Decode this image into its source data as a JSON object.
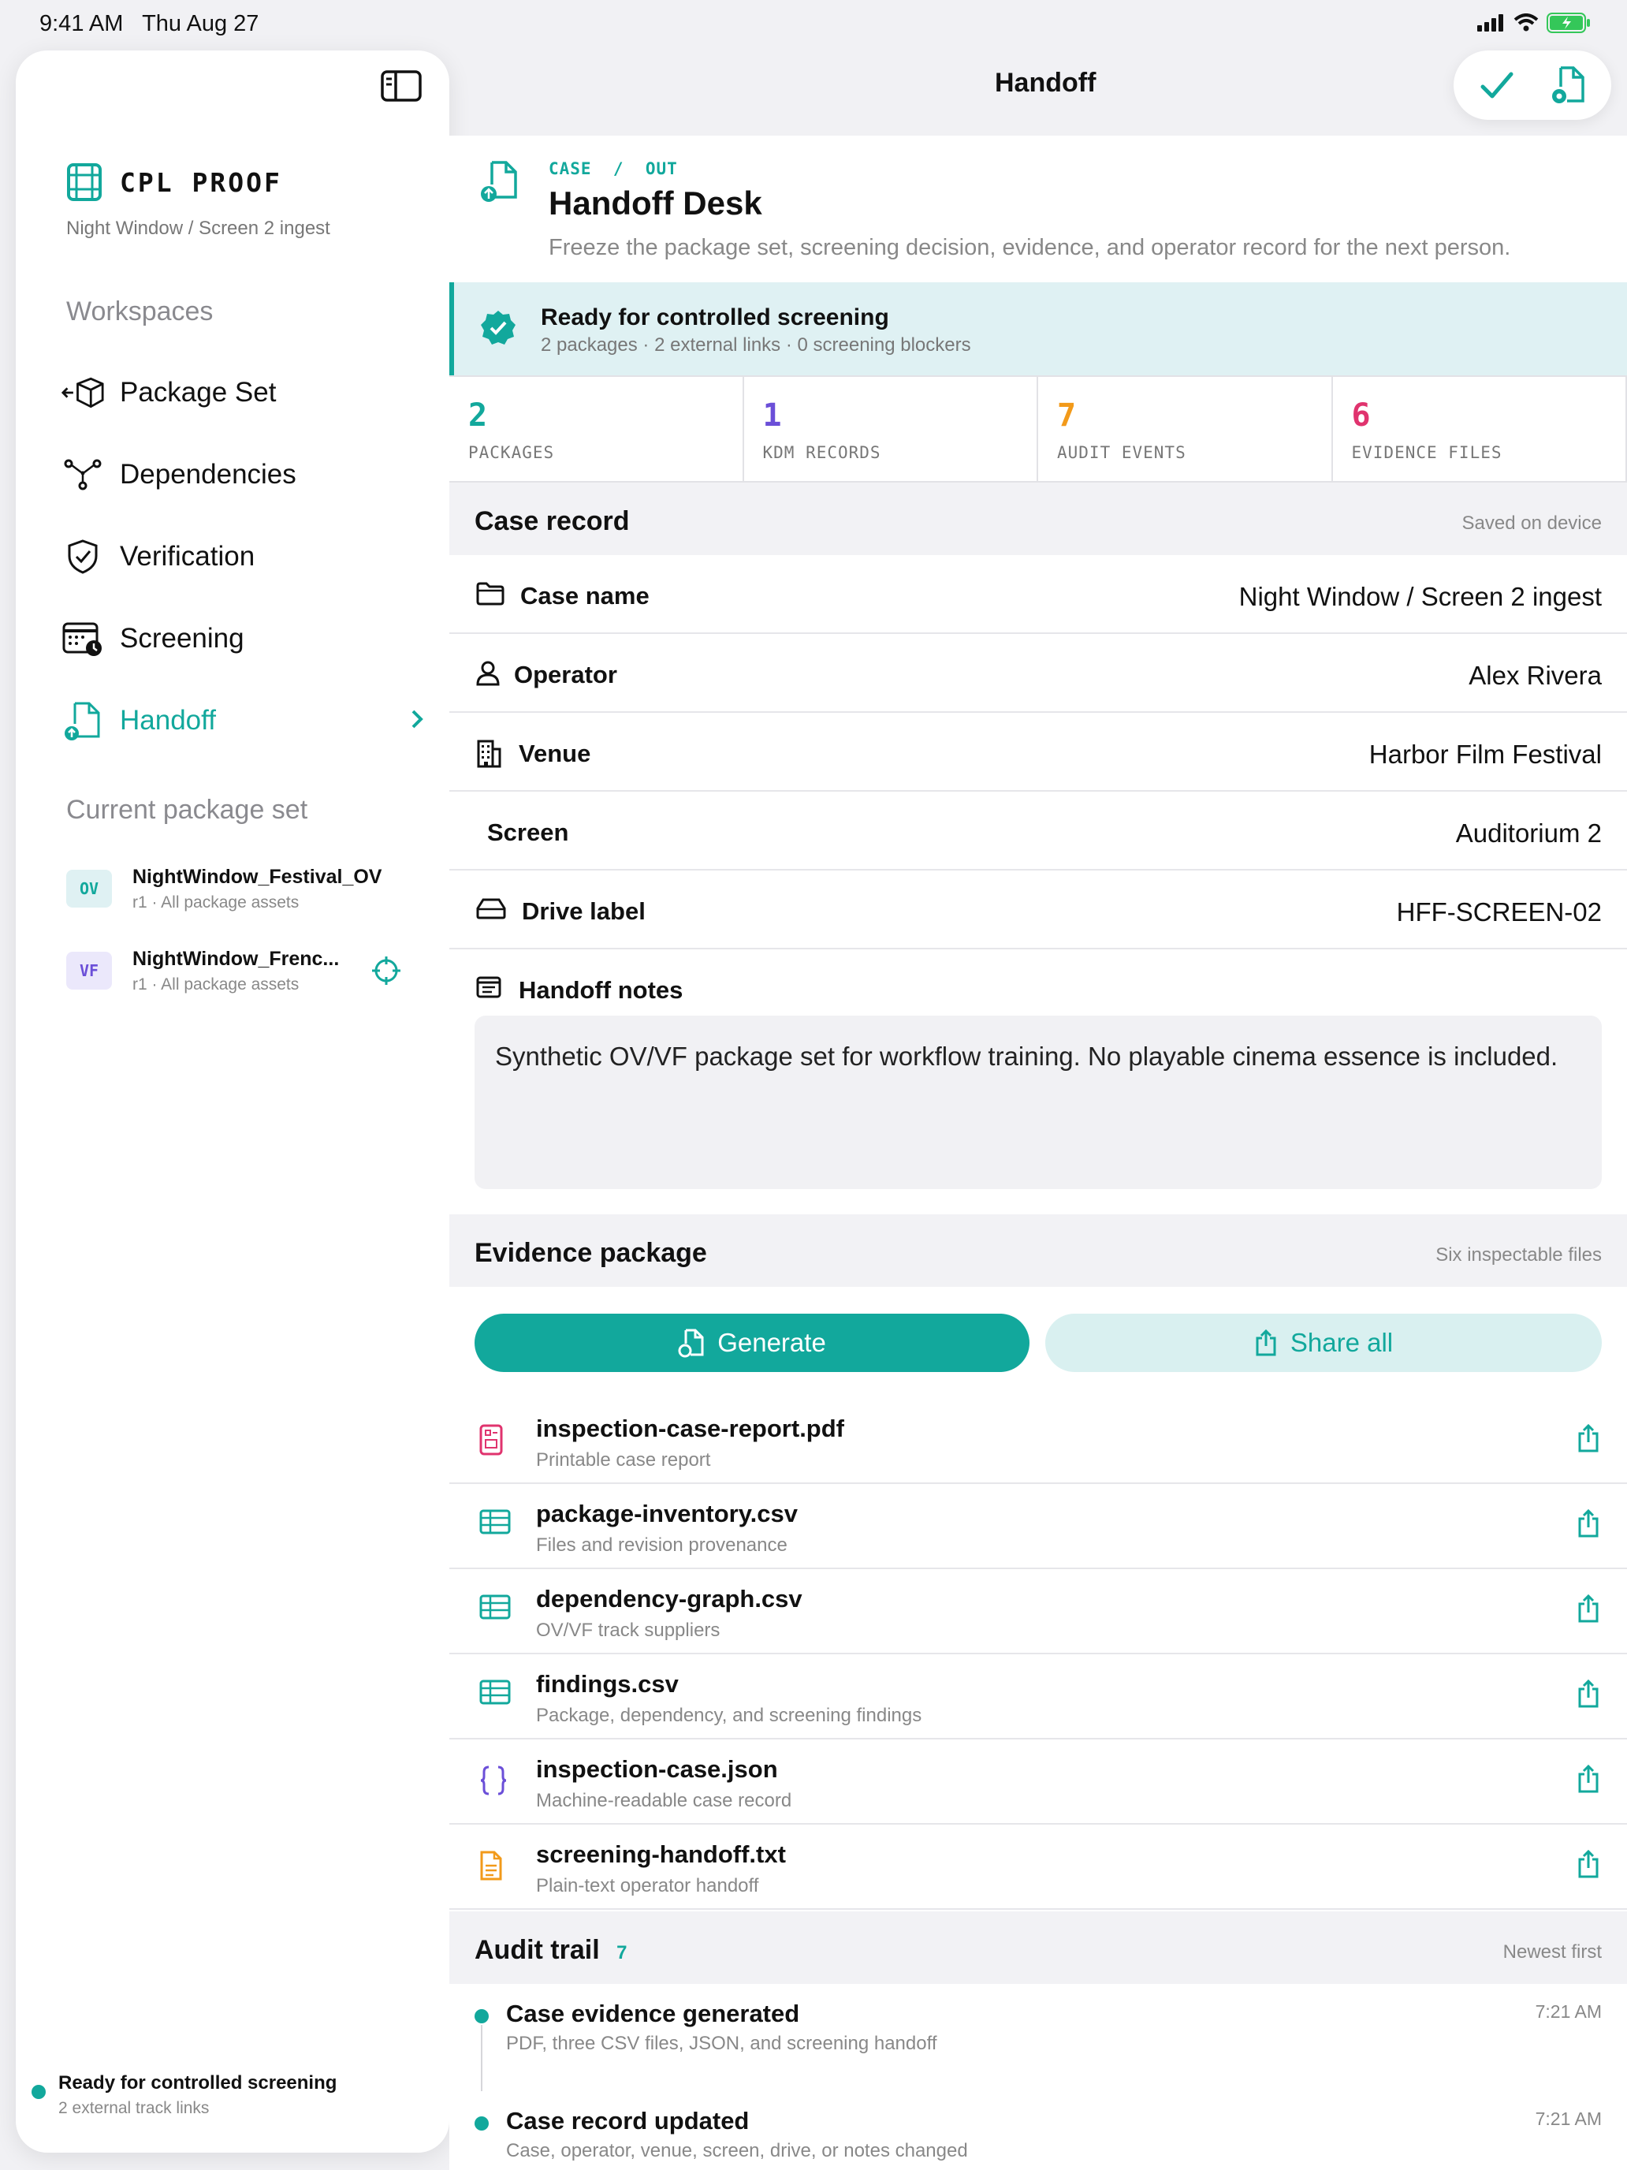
{
  "status_bar": {
    "time": "9:41 AM",
    "date": "Thu Aug 27"
  },
  "sidebar": {
    "brand_title": "CPL PROOF",
    "brand_sub": "Night Window / Screen 2 ingest",
    "workspaces_label": "Workspaces",
    "items": [
      {
        "label": "Package Set",
        "icon": "package-icon"
      },
      {
        "label": "Dependencies",
        "icon": "graph-icon"
      },
      {
        "label": "Verification",
        "icon": "shield-icon"
      },
      {
        "label": "Screening",
        "icon": "calendar-clock-icon"
      },
      {
        "label": "Handoff",
        "icon": "document-upload-icon",
        "active": true
      }
    ],
    "package_set_label": "Current package set",
    "packages": [
      {
        "badge": "OV",
        "name": "NightWindow_Festival_OV",
        "sub": "r1 · All package assets"
      },
      {
        "badge": "VF",
        "name": "NightWindow_Frenc...",
        "sub": "r1 · All package assets"
      }
    ],
    "footer_title": "Ready for controlled screening",
    "footer_sub": "2 external track links"
  },
  "header": {
    "title": "Handoff"
  },
  "case": {
    "crumb_case": "CASE",
    "crumb_sep": "/",
    "crumb_out": "OUT",
    "title": "Handoff Desk",
    "subtitle": "Freeze the package set, screening decision, evidence, and operator record for the next person."
  },
  "ready": {
    "title": "Ready for controlled screening",
    "sub": "2 packages · 2 external links · 0 screening blockers"
  },
  "stats": [
    {
      "num": "2",
      "label": "PACKAGES",
      "color": "#12a89c"
    },
    {
      "num": "1",
      "label": "KDM RECORDS",
      "color": "#6b4fd8"
    },
    {
      "num": "7",
      "label": "AUDIT EVENTS",
      "color": "#f29a1a"
    },
    {
      "num": "6",
      "label": "EVIDENCE FILES",
      "color": "#e0336e"
    }
  ],
  "case_record": {
    "title": "Case record",
    "meta": "Saved on device",
    "rows": [
      {
        "label": "Case name",
        "value": "Night Window / Screen 2 ingest"
      },
      {
        "label": "Operator",
        "value": "Alex Rivera"
      },
      {
        "label": "Venue",
        "value": "Harbor Film Festival"
      },
      {
        "label": "Screen",
        "value": "Auditorium 2"
      },
      {
        "label": "Drive label",
        "value": "HFF-SCREEN-02"
      }
    ],
    "notes_label": "Handoff notes",
    "notes_value": "Synthetic OV/VF package set for workflow training. No playable cinema essence is included."
  },
  "evidence": {
    "title": "Evidence package",
    "meta": "Six inspectable files",
    "generate_label": "Generate",
    "share_label": "Share all",
    "files": [
      {
        "name": "inspection-case-report.pdf",
        "sub": "Printable case report"
      },
      {
        "name": "package-inventory.csv",
        "sub": "Files and revision provenance"
      },
      {
        "name": "dependency-graph.csv",
        "sub": "OV/VF track suppliers"
      },
      {
        "name": "findings.csv",
        "sub": "Package, dependency, and screening findings"
      },
      {
        "name": "inspection-case.json",
        "sub": "Machine-readable case record"
      },
      {
        "name": "screening-handoff.txt",
        "sub": "Plain-text operator handoff"
      }
    ]
  },
  "audit": {
    "title": "Audit trail",
    "count": "7",
    "meta": "Newest first",
    "events": [
      {
        "title": "Case evidence generated",
        "sub": "PDF, three CSV files, JSON, and screening handoff",
        "time": "7:21 AM"
      },
      {
        "title": "Case record updated",
        "sub": "Case, operator, venue, screen, drive, or notes changed",
        "time": "7:21 AM"
      }
    ]
  },
  "colors": {
    "accent": "#12a89c",
    "accent_light": "#dff1f3"
  }
}
